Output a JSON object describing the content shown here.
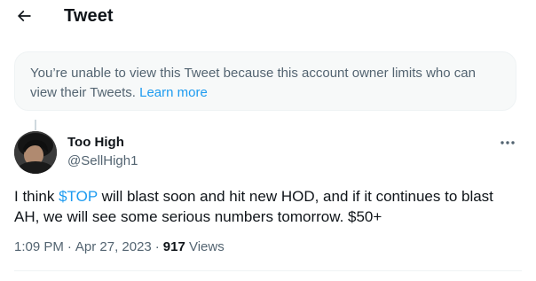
{
  "header": {
    "title": "Tweet",
    "back_icon": "back-arrow-icon"
  },
  "notice": {
    "message": "You’re unable to view this Tweet because this account owner limits who can view their Tweets.",
    "link_label": "Learn more",
    "link_color": "#1d9bf0"
  },
  "tweet": {
    "author": {
      "name": "Too High",
      "handle": "@SellHigh1"
    },
    "text_before_cashtag": "I think ",
    "cashtag": "$TOP",
    "text_after_cashtag": " will blast soon and hit new HOD, and if it continues to blast AH, we will see some serious numbers tomorrow. $50+",
    "time": "1:09 PM",
    "date": "Apr 27, 2023",
    "separator": "·",
    "views_count": "917",
    "views_label": "Views"
  },
  "colors": {
    "accent": "#1d9bf0",
    "text_primary": "#0f1419",
    "text_secondary": "#536471",
    "notice_bg": "#f7f9f9"
  }
}
